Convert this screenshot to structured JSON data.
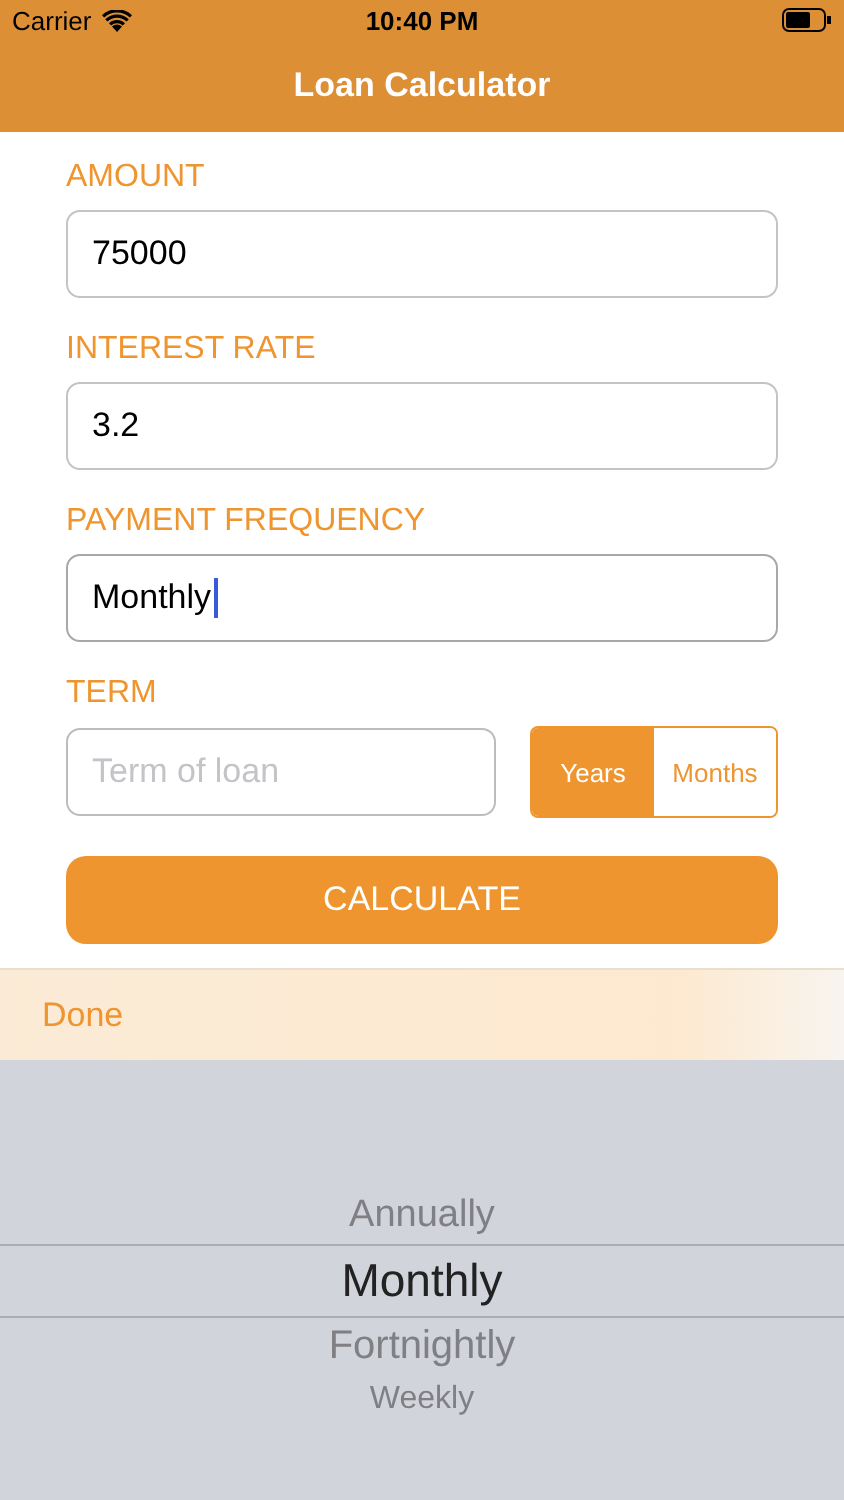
{
  "status_bar": {
    "carrier": "Carrier",
    "time": "10:40 PM"
  },
  "nav_bar": {
    "title": "Loan Calculator"
  },
  "form": {
    "fields": [
      {
        "label": "AMOUNT",
        "value": "75000",
        "focused": false
      },
      {
        "label": "INTEREST RATE",
        "value": "3.2",
        "focused": false
      },
      {
        "label": "PAYMENT FREQUENCY",
        "value": "Monthly",
        "focused": true
      }
    ],
    "term": {
      "label": "TERM",
      "placeholder": "Term of loan",
      "units": [
        {
          "label": "Years",
          "selected": true
        },
        {
          "label": "Months",
          "selected": false
        }
      ]
    },
    "calculate_button": "CALCULATE"
  },
  "toolbar": {
    "done": "Done"
  },
  "picker": {
    "options": [
      {
        "label": "Annually",
        "selected": false
      },
      {
        "label": "Monthly",
        "selected": true
      },
      {
        "label": "Fortnightly",
        "selected": false
      },
      {
        "label": "Weekly",
        "selected": false
      }
    ]
  }
}
